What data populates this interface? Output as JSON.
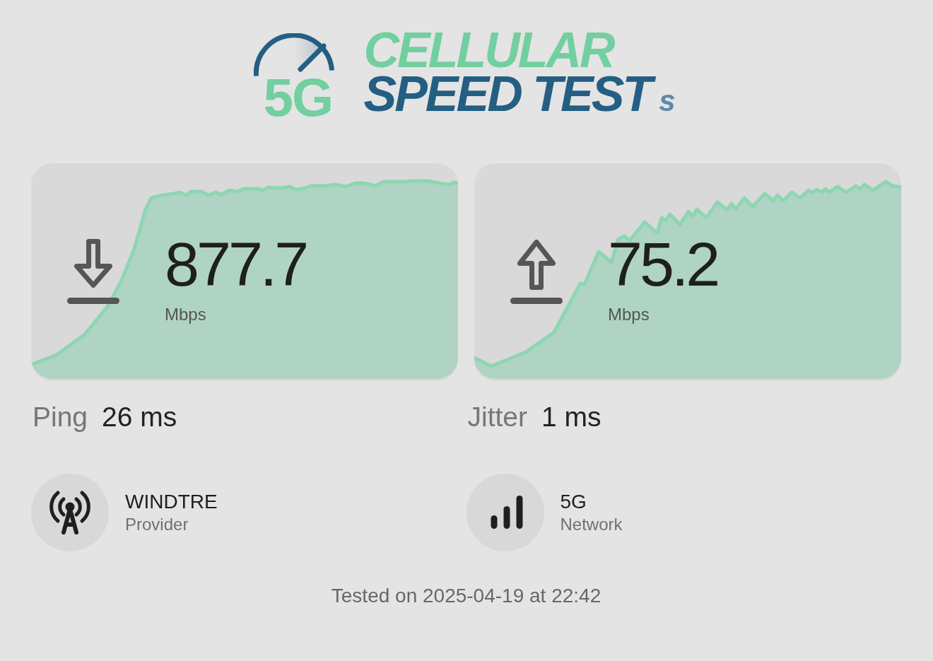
{
  "logo": {
    "badge": "5G",
    "line_1": "CELLULAR",
    "line_2": "SPEED TEST",
    "suffix": "s"
  },
  "results": [
    {
      "kind": "download",
      "value": "877.7",
      "unit": "Mbps"
    },
    {
      "kind": "upload",
      "value": "75.2",
      "unit": "Mbps"
    }
  ],
  "latency": [
    {
      "label": "Ping",
      "value": "26 ms"
    },
    {
      "label": "Jitter",
      "value": "1 ms"
    }
  ],
  "details": [
    {
      "kind": "provider",
      "value": "WINDTRE",
      "label": "Provider"
    },
    {
      "kind": "network",
      "value": "5G",
      "label": "Network"
    }
  ],
  "footer": "Tested on 2025-04-19 at 22:42"
}
